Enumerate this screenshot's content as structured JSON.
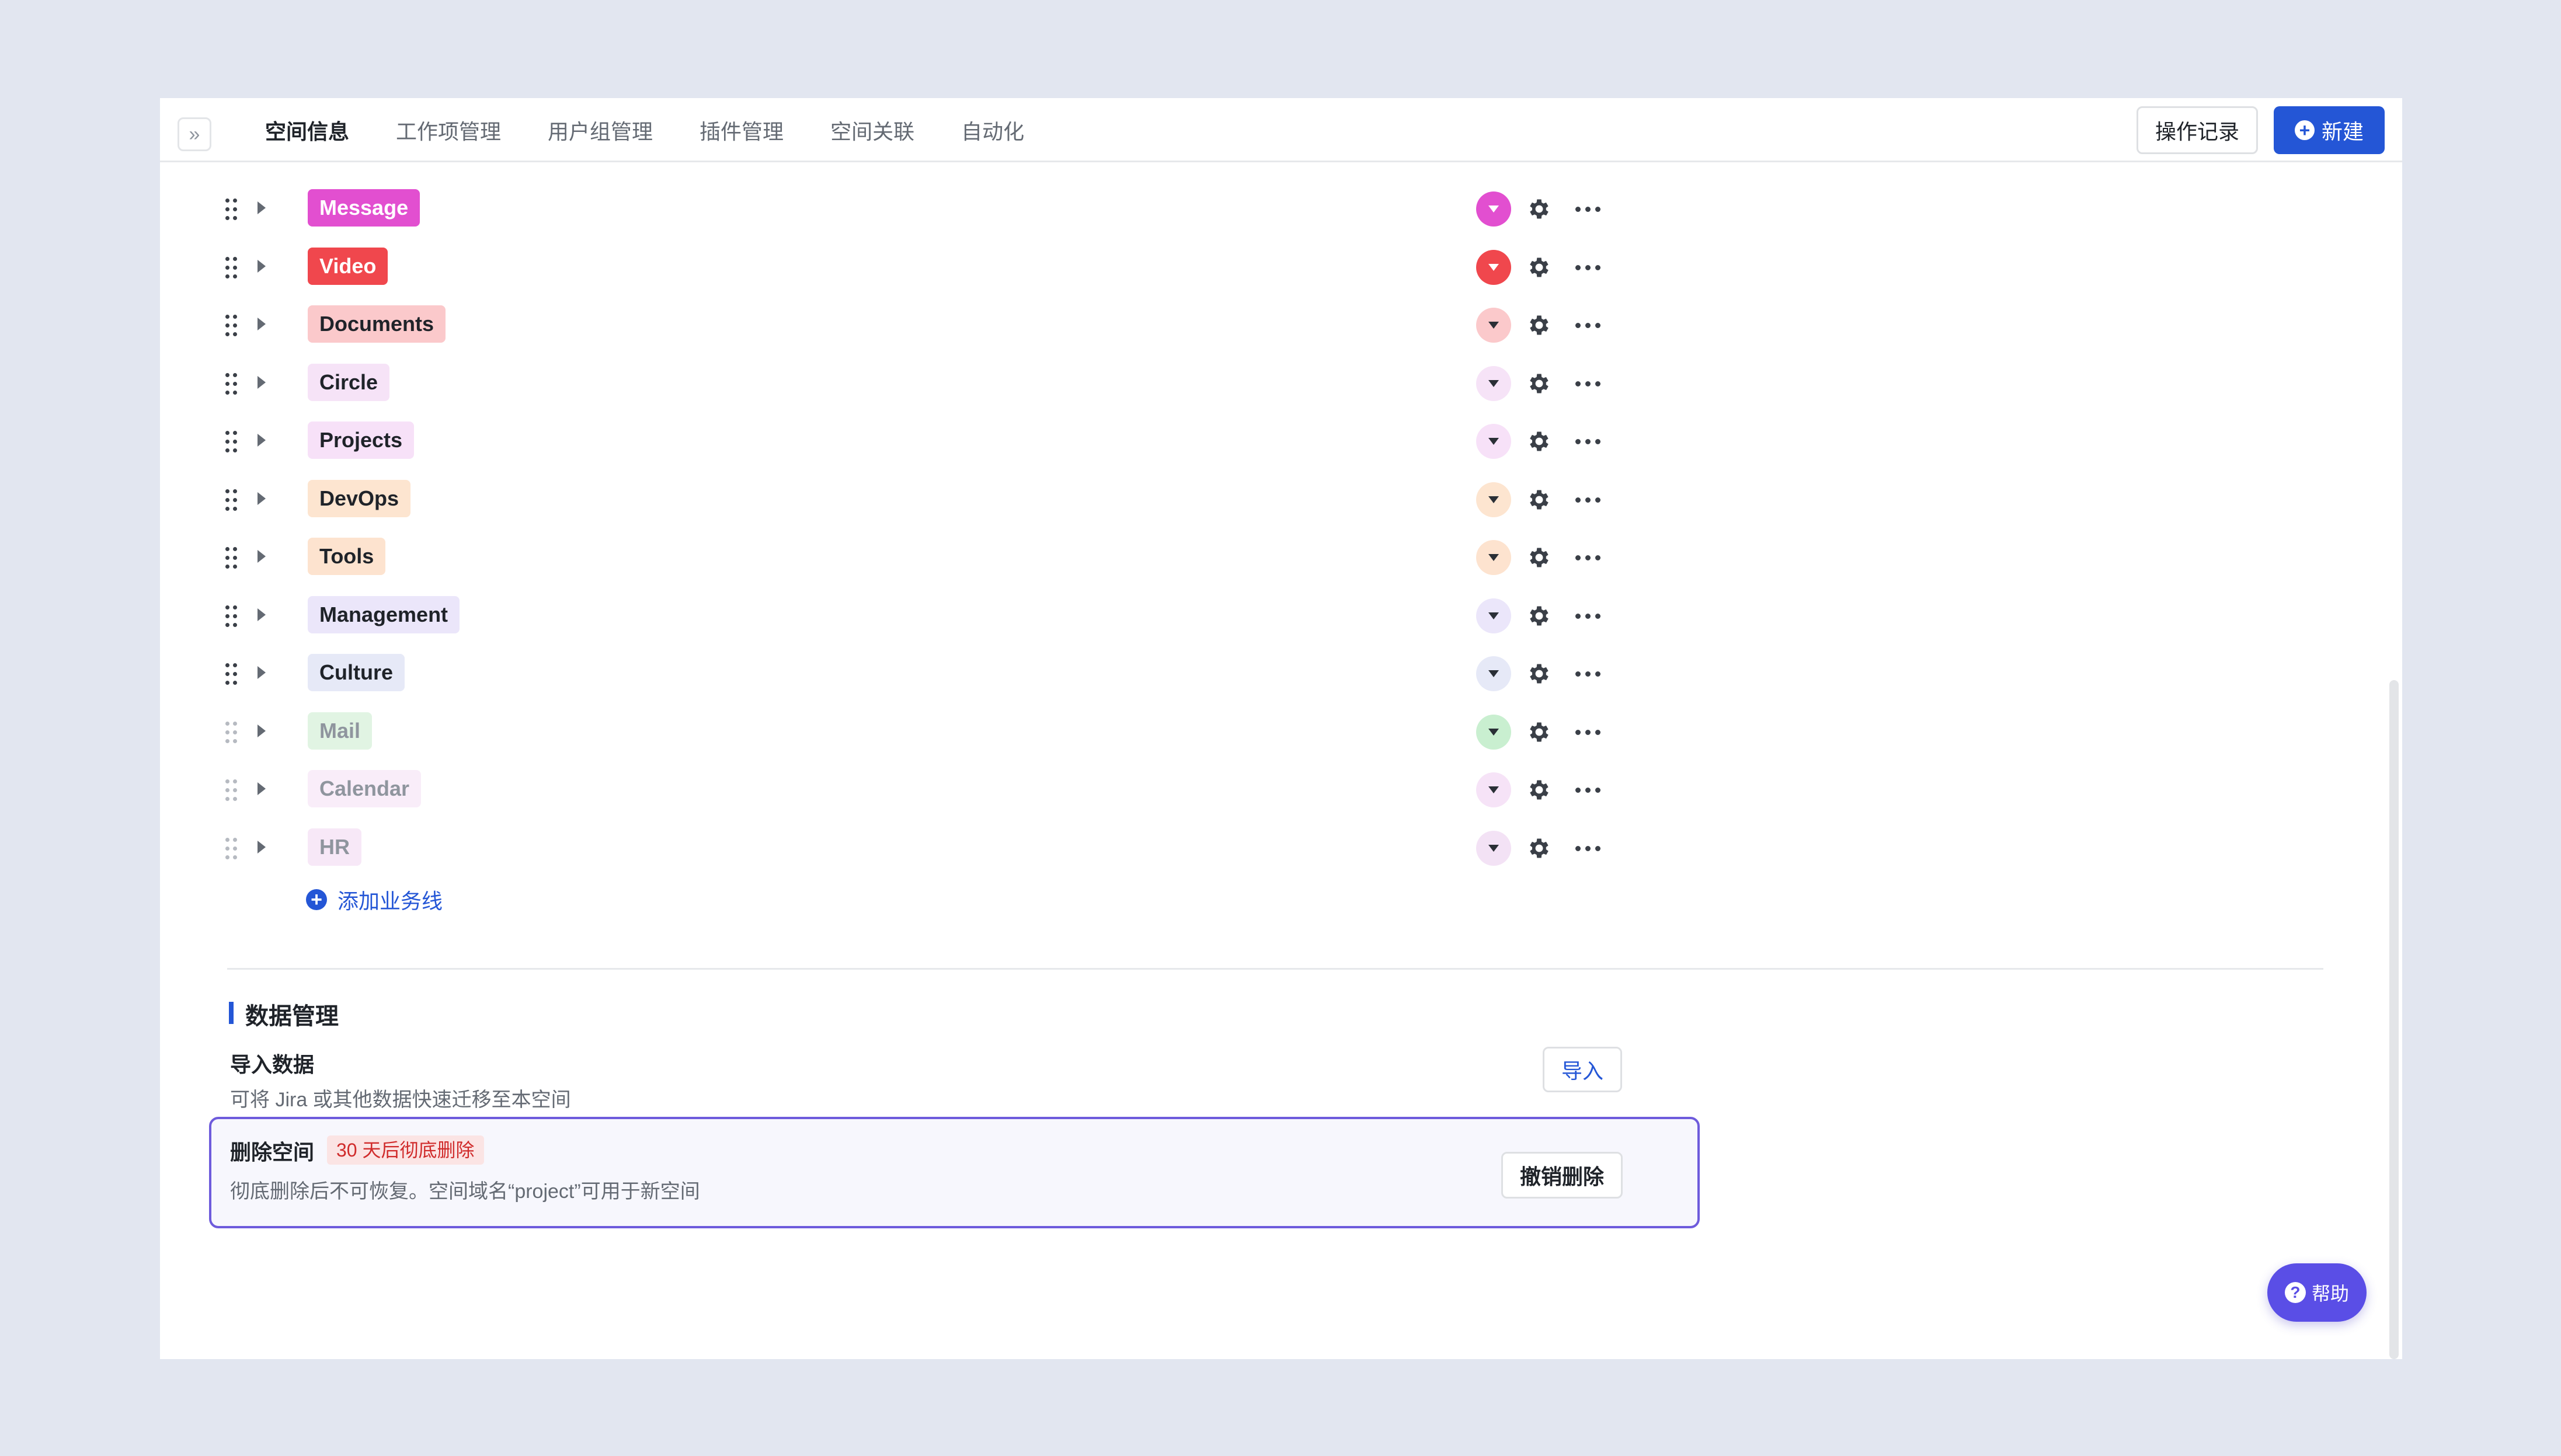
{
  "tabs": [
    {
      "label": "空间信息",
      "active": true
    },
    {
      "label": "工作项管理"
    },
    {
      "label": "用户组管理"
    },
    {
      "label": "插件管理"
    },
    {
      "label": "空间关联"
    },
    {
      "label": "自动化"
    }
  ],
  "toolbar": {
    "log_label": "操作记录",
    "new_label": "新建"
  },
  "business_lines": [
    {
      "label": "Message",
      "tag_bg": "#e24fd0",
      "tag_fg": "#ffffff",
      "dd_bg": "#e24fd0",
      "dim": false
    },
    {
      "label": "Video",
      "tag_bg": "#f0474d",
      "tag_fg": "#ffffff",
      "dd_bg": "#f0474d",
      "dim": false
    },
    {
      "label": "Documents",
      "tag_bg": "#fbc9cb",
      "tag_fg": "#1f2329",
      "dd_bg": "#fbc9cb",
      "dim": false
    },
    {
      "label": "Circle",
      "tag_bg": "#f6e3f7",
      "tag_fg": "#1f2329",
      "dd_bg": "#f6e3f7",
      "dim": false
    },
    {
      "label": "Projects",
      "tag_bg": "#f7e1f8",
      "tag_fg": "#1f2329",
      "dd_bg": "#f7e1f8",
      "dim": false
    },
    {
      "label": "DevOps",
      "tag_bg": "#fde5d0",
      "tag_fg": "#1f2329",
      "dd_bg": "#fde5d0",
      "dim": false
    },
    {
      "label": "Tools",
      "tag_bg": "#fde3cf",
      "tag_fg": "#1f2329",
      "dd_bg": "#fde3cf",
      "dim": false
    },
    {
      "label": "Management",
      "tag_bg": "#ebe6fa",
      "tag_fg": "#1f2329",
      "dd_bg": "#ebe6fa",
      "dim": false
    },
    {
      "label": "Culture",
      "tag_bg": "#e6e9f7",
      "tag_fg": "#1f2329",
      "dd_bg": "#e6e9f7",
      "dim": false
    },
    {
      "label": "Mail",
      "tag_bg": "#e1f4e3",
      "tag_fg": "#8f959e",
      "dd_bg": "#c9efd0",
      "dim": true
    },
    {
      "label": "Calendar",
      "tag_bg": "#f9edf9",
      "tag_fg": "#8f959e",
      "dd_bg": "#f6e3f7",
      "dim": true
    },
    {
      "label": "HR",
      "tag_bg": "#f7e8f7",
      "tag_fg": "#8f959e",
      "dd_bg": "#f3e2f5",
      "dim": true
    }
  ],
  "add_line_label": "添加业务线",
  "data_section": {
    "title": "数据管理",
    "import": {
      "title": "导入数据",
      "desc": "可将 Jira 或其他数据快速迁移至本空间",
      "button": "导入"
    },
    "delete": {
      "title": "删除空间",
      "badge": "30 天后彻底删除",
      "desc": "彻底删除后不可恢复。空间域名“project”可用于新空间",
      "button": "撤销删除"
    }
  },
  "help_label": "帮助",
  "colors": {
    "accent": "#2456d6",
    "delete_border": "#6e5bdc",
    "help_bg": "#5a4ee6"
  }
}
